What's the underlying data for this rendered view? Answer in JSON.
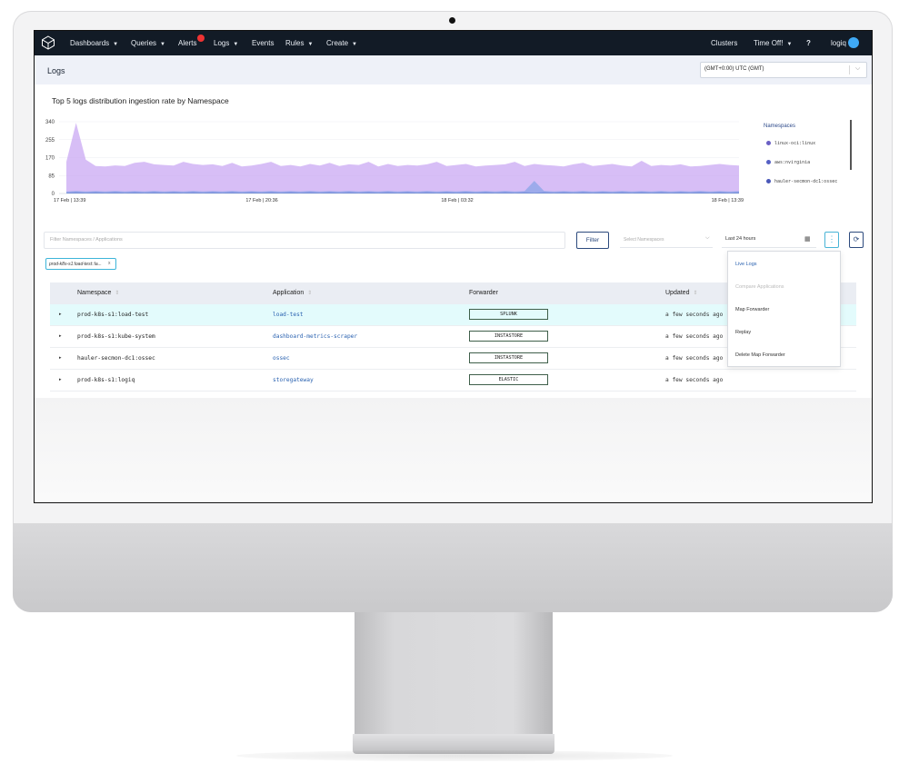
{
  "nav": {
    "left_items": [
      {
        "label": "Dashboards",
        "caret": true
      },
      {
        "label": "Queries",
        "caret": true
      },
      {
        "label": "Alerts",
        "caret": false
      },
      {
        "label": "Logs",
        "caret": true
      },
      {
        "label": "Events",
        "caret": false
      },
      {
        "label": "Rules",
        "caret": true
      },
      {
        "label": "Create",
        "caret": true
      }
    ],
    "clusters": "Clusters",
    "time_off": "Time Off!",
    "help_icon": "?",
    "user": "logiq",
    "logo_icon": "cube-logo-icon"
  },
  "page": {
    "title": "Logs",
    "timezone": "(GMT+0:00) UTC (GMT)"
  },
  "chart_title": "Top 5 logs distribution ingestion rate by Namespace",
  "chart_data": {
    "type": "area",
    "title": "Top 5 logs distribution ingestion rate by Namespace",
    "y_ticks": [
      0,
      85,
      170,
      255,
      340
    ],
    "ylim": [
      0,
      340
    ],
    "x_tick_labels": [
      "17 Feb | 13:39",
      "17 Feb | 20:36",
      "18 Feb | 03:32",
      "18 Feb | 13:39"
    ],
    "legend_title": "Namespaces",
    "legend": [
      "linux-oci:linux",
      "aws:nvirginia",
      "hauler-secmon-dc1:ossec"
    ],
    "grid": true,
    "legend_placement": "right",
    "series": [
      {
        "name": "linux-oci:linux",
        "color": "#c9a8f3",
        "values": [
          150,
          335,
          160,
          130,
          128,
          133,
          130,
          145,
          150,
          138,
          135,
          132,
          150,
          140,
          135,
          138,
          130,
          145,
          128,
          132,
          140,
          150,
          130,
          135,
          128,
          140,
          132,
          145,
          130,
          138,
          135,
          150,
          128,
          140,
          130,
          135,
          132,
          138,
          150,
          130,
          135,
          140,
          128,
          132,
          135,
          138,
          150,
          130,
          140,
          135,
          132,
          128,
          138,
          145,
          130,
          135,
          140,
          132,
          128,
          155,
          130,
          135,
          132,
          138,
          128,
          130,
          135,
          140,
          135,
          132
        ]
      },
      {
        "name": "aws:nvirginia",
        "color": "#8fa6e8",
        "values": [
          10,
          12,
          10,
          11,
          10,
          12,
          10,
          11,
          10,
          12,
          10,
          11,
          10,
          12,
          10,
          11,
          10,
          12,
          10,
          11,
          10,
          12,
          10,
          11,
          10,
          12,
          10,
          11,
          10,
          12,
          10,
          11,
          10,
          12,
          10,
          11,
          10,
          12,
          10,
          11,
          10,
          12,
          10,
          11,
          10,
          12,
          10,
          11,
          60,
          12,
          10,
          11,
          10,
          12,
          10,
          11,
          10,
          12,
          10,
          11,
          10,
          12,
          10,
          11,
          10,
          12,
          10,
          11,
          10,
          11
        ]
      },
      {
        "name": "hauler-secmon-dc1:ossec",
        "color": "#4b6fd1",
        "values": [
          4,
          5,
          4,
          5,
          4,
          5,
          4,
          5,
          4,
          5,
          4,
          5,
          4,
          5,
          4,
          5,
          4,
          5,
          4,
          5,
          4,
          5,
          4,
          5,
          4,
          5,
          4,
          5,
          4,
          5,
          4,
          5,
          4,
          5,
          4,
          5,
          4,
          5,
          4,
          5,
          4,
          5,
          4,
          5,
          4,
          5,
          4,
          5,
          4,
          5,
          4,
          5,
          4,
          5,
          4,
          5,
          4,
          5,
          4,
          5,
          4,
          5,
          4,
          5,
          4,
          5,
          4,
          5,
          4,
          5
        ]
      }
    ]
  },
  "filters": {
    "search_placeholder": "Filter Namespaces / Applications",
    "filter_button": "Filter",
    "namespace_placeholder": "Select Namespaces",
    "time_range": "Last 24 hours",
    "active_chip": "prod-k8s-s1:load-test::la...",
    "chip_close": "x",
    "more_icon": "⋮",
    "refresh_icon": "⟳"
  },
  "table": {
    "headers": {
      "namespace": "Namespace",
      "application": "Application",
      "forwarder": "Forwarder",
      "updated": "Updated"
    },
    "rows": [
      {
        "namespace": "prod-k8s-s1:load-test",
        "application": "load-test",
        "forwarder": "SPLUNK",
        "updated": "a few seconds ago"
      },
      {
        "namespace": "prod-k8s-s1:kube-system",
        "application": "dashboard-metrics-scraper",
        "forwarder": "INSTASTORE",
        "updated": "a few seconds ago"
      },
      {
        "namespace": "hauler-secmon-dc1:ossec",
        "application": "ossec",
        "forwarder": "INSTASTORE",
        "updated": "a few seconds ago"
      },
      {
        "namespace": "prod-k8s-s1:logiq",
        "application": "storegateway",
        "forwarder": "ELASTIC",
        "updated": "a few seconds ago"
      }
    ]
  },
  "menu": {
    "items": [
      {
        "label": "Live Logs",
        "color": "#2a62b0"
      },
      {
        "label": "Compare Applications",
        "color": "#bbbbbb"
      },
      {
        "label": "Map Forwarder",
        "color": "#333333"
      },
      {
        "label": "Replay",
        "color": "#333333"
      },
      {
        "label": "Delete Map Forwarder",
        "color": "#333333"
      }
    ]
  }
}
